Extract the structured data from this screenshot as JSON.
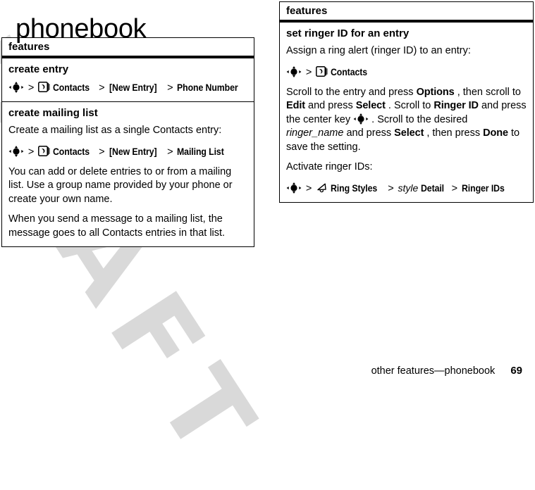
{
  "page_title": "phonebook",
  "watermark": "DRAFT",
  "tables": {
    "left": {
      "header": "features",
      "sections": [
        {
          "title": "create entry",
          "blocks": [
            {
              "kind": "path",
              "parts": [
                {
                  "type": "icon",
                  "icon": "nav-key-icon"
                },
                {
                  "type": "sep",
                  "text": ">"
                },
                {
                  "type": "icon",
                  "icon": "contacts-icon"
                },
                {
                  "type": "bold",
                  "text": "Contacts"
                },
                {
                  "type": "sep",
                  "text": ">"
                },
                {
                  "type": "bold",
                  "text": "[New Entry]"
                },
                {
                  "type": "sep",
                  "text": ">"
                },
                {
                  "type": "bold",
                  "text": "Phone Number"
                }
              ]
            }
          ]
        },
        {
          "title": "create mailing list",
          "blocks": [
            {
              "kind": "para",
              "text": "Create a mailing list as a single Contacts entry:"
            },
            {
              "kind": "path",
              "parts": [
                {
                  "type": "icon",
                  "icon": "nav-key-icon"
                },
                {
                  "type": "sep",
                  "text": ">"
                },
                {
                  "type": "icon",
                  "icon": "contacts-icon"
                },
                {
                  "type": "bold",
                  "text": "Contacts"
                },
                {
                  "type": "sep",
                  "text": ">"
                },
                {
                  "type": "bold",
                  "text": "[New Entry]"
                },
                {
                  "type": "sep",
                  "text": ">"
                },
                {
                  "type": "bold",
                  "text": "Mailing List"
                }
              ]
            },
            {
              "kind": "para",
              "text": "You can add or delete entries to or from a mailing list. Use a group name provided by your phone or create your own name."
            },
            {
              "kind": "para",
              "text": "When you send a message to a mailing list, the message goes to all Contacts entries in that list."
            }
          ]
        }
      ]
    },
    "right": {
      "header": "features",
      "sections": [
        {
          "title": "set ringer ID for an entry",
          "blocks": [
            {
              "kind": "para",
              "text": "Assign a ring alert (ringer ID) to an entry:"
            },
            {
              "kind": "path",
              "parts": [
                {
                  "type": "icon",
                  "icon": "nav-key-icon"
                },
                {
                  "type": "sep",
                  "text": ">"
                },
                {
                  "type": "icon",
                  "icon": "contacts-icon"
                },
                {
                  "type": "bold",
                  "text": "Contacts"
                }
              ]
            },
            {
              "kind": "rich",
              "parts": [
                {
                  "type": "text",
                  "text": "Scroll to the entry and press "
                },
                {
                  "type": "bold",
                  "text": "Options"
                },
                {
                  "type": "text",
                  "text": ", then scroll to "
                },
                {
                  "type": "bold",
                  "text": "Edit"
                },
                {
                  "type": "text",
                  "text": " and press "
                },
                {
                  "type": "bold",
                  "text": "Select"
                },
                {
                  "type": "text",
                  "text": ". Scroll to "
                },
                {
                  "type": "bold",
                  "text": "Ringer ID"
                },
                {
                  "type": "text",
                  "text": " and press the center key "
                },
                {
                  "type": "icon",
                  "icon": "nav-key-icon"
                },
                {
                  "type": "text",
                  "text": ". Scroll to the desired "
                },
                {
                  "type": "italic",
                  "text": "ringer_name"
                },
                {
                  "type": "text",
                  "text": " and press "
                },
                {
                  "type": "bold",
                  "text": "Select"
                },
                {
                  "type": "text",
                  "text": ", then press "
                },
                {
                  "type": "bold",
                  "text": "Done"
                },
                {
                  "type": "text",
                  "text": " to save the setting."
                }
              ]
            },
            {
              "kind": "para",
              "text": "Activate ringer IDs:"
            },
            {
              "kind": "path",
              "parts": [
                {
                  "type": "icon",
                  "icon": "nav-key-icon"
                },
                {
                  "type": "sep",
                  "text": ">"
                },
                {
                  "type": "icon",
                  "icon": "bell-icon"
                },
                {
                  "type": "bold",
                  "text": "Ring Styles"
                },
                {
                  "type": "sep",
                  "text": ">"
                },
                {
                  "type": "italic",
                  "text": "style"
                },
                {
                  "type": "bold",
                  "text": "Detail"
                },
                {
                  "type": "sep",
                  "text": ">"
                },
                {
                  "type": "bold",
                  "text": "Ringer IDs"
                }
              ]
            }
          ]
        }
      ]
    }
  },
  "footer": {
    "label": "other features—phonebook",
    "page_number": "69"
  },
  "colors": {
    "text": "#000000",
    "background": "#ffffff",
    "watermark": "#d9d9d9",
    "rule": "#000000"
  }
}
